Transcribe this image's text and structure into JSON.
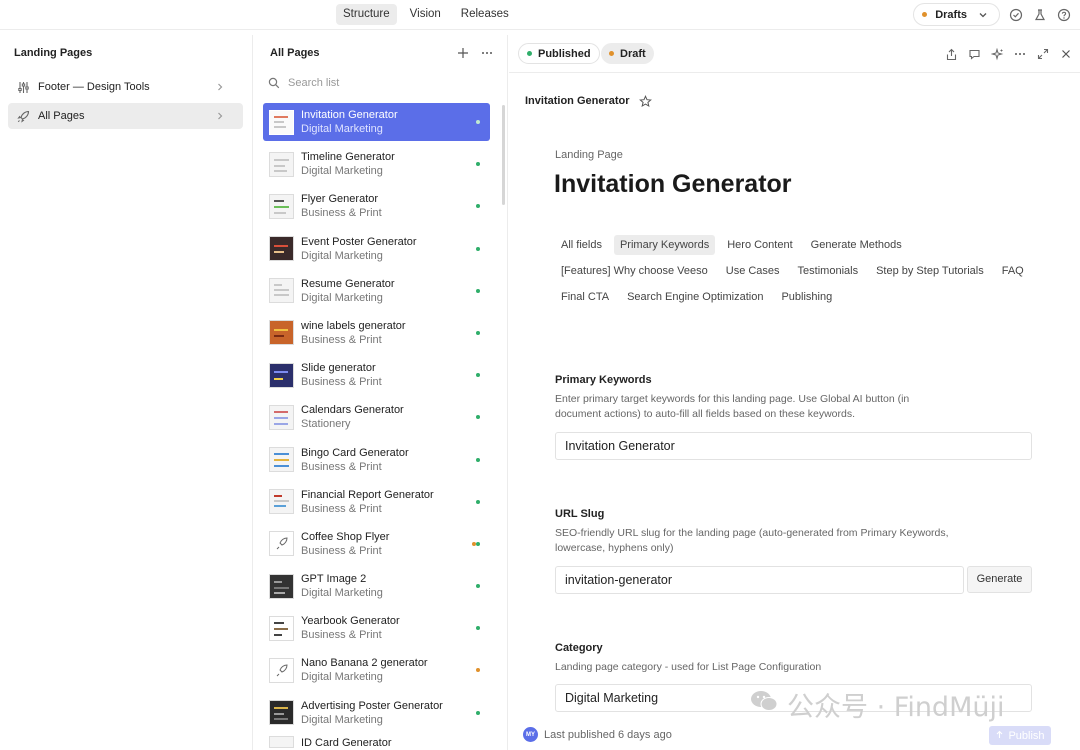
{
  "top": {
    "tabs": [
      {
        "label": "Structure"
      },
      {
        "label": "Vision"
      },
      {
        "label": "Releases"
      }
    ],
    "drafts_label": "Drafts"
  },
  "sidebar": {
    "title": "Landing Pages",
    "items": [
      {
        "label": "Footer — Design Tools"
      },
      {
        "label": "All Pages"
      }
    ]
  },
  "list": {
    "title": "All Pages",
    "search_placeholder": "Search list",
    "items": [
      {
        "name": "Invitation Generator",
        "category": "Digital Marketing"
      },
      {
        "name": "Timeline Generator",
        "category": "Digital Marketing"
      },
      {
        "name": "Flyer Generator",
        "category": "Business & Print"
      },
      {
        "name": "Event Poster Generator",
        "category": "Digital Marketing"
      },
      {
        "name": "Resume Generator",
        "category": "Digital Marketing"
      },
      {
        "name": "wine labels generator",
        "category": "Business & Print"
      },
      {
        "name": "Slide generator",
        "category": "Business & Print"
      },
      {
        "name": "Calendars Generator",
        "category": "Stationery"
      },
      {
        "name": "Bingo Card Generator",
        "category": "Business & Print"
      },
      {
        "name": "Financial Report Generator",
        "category": "Business & Print"
      },
      {
        "name": "Coffee Shop Flyer",
        "category": "Business & Print"
      },
      {
        "name": "GPT Image 2",
        "category": "Digital Marketing"
      },
      {
        "name": "Yearbook Generator",
        "category": "Business & Print"
      },
      {
        "name": "Nano Banana 2 generator",
        "category": "Digital Marketing"
      },
      {
        "name": "Advertising Poster Generator",
        "category": "Digital Marketing"
      },
      {
        "name": "ID Card Generator",
        "category": ""
      }
    ]
  },
  "detail": {
    "published_label": "Published",
    "draft_label": "Draft",
    "breadcrumb_title": "Invitation Generator",
    "eyebrow": "Landing Page",
    "title": "Invitation Generator",
    "field_tabs": [
      {
        "label": "All fields"
      },
      {
        "label": "Primary Keywords"
      },
      {
        "label": "Hero Content"
      },
      {
        "label": "Generate Methods"
      },
      {
        "label": "[Features] Why choose Veeso"
      },
      {
        "label": "Use Cases"
      },
      {
        "label": "Testimonials"
      },
      {
        "label": "Step by Step Tutorials"
      },
      {
        "label": "FAQ"
      },
      {
        "label": "Final CTA"
      },
      {
        "label": "Search Engine Optimization"
      },
      {
        "label": "Publishing"
      }
    ],
    "primary_keywords": {
      "label": "Primary Keywords",
      "help": "Enter primary target keywords for this landing page. Use Global AI button (in document actions) to auto-fill all fields based on these keywords.",
      "value": "Invitation Generator"
    },
    "url_slug": {
      "label": "URL Slug",
      "help": "SEO-friendly URL slug for the landing page (auto-generated from Primary Keywords, lowercase, hyphens only)",
      "value": "invitation-generator",
      "generate_label": "Generate"
    },
    "category": {
      "label": "Category",
      "help": "Landing page category - used for List Page Configuration",
      "value": "Digital Marketing"
    },
    "footer": {
      "avatar_initials": "MY",
      "last_published": "Last published 6 days ago",
      "publish_label": "Publish"
    }
  },
  "watermark": {
    "text": "公众号 · FindMüji"
  }
}
